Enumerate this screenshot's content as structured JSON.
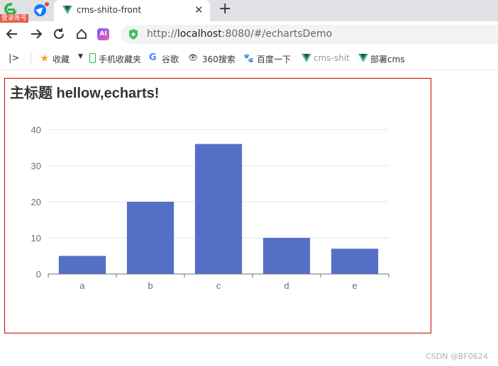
{
  "browser": {
    "login_badge": "登录账号",
    "tab": {
      "title": "cms-shito-front"
    },
    "new_tab_glyph": "+",
    "close_glyph": "✕",
    "ai_badge": "AI",
    "address": {
      "prefix": "http://",
      "host": "localhost",
      "rest": ":8080/#/echartsDemo"
    }
  },
  "bookmarks": [
    {
      "label": "收藏",
      "icon": "star-icon"
    },
    {
      "label": "手机收藏夹",
      "icon": "phone-icon"
    },
    {
      "label": "谷歌",
      "icon": "google-icon"
    },
    {
      "label": "360搜索",
      "icon": "eye-icon"
    },
    {
      "label": "百度一下",
      "icon": "baidu-paw-icon"
    },
    {
      "label": "cms-shit",
      "icon": "vue-icon"
    },
    {
      "label": "部署cms",
      "icon": "vue-icon"
    }
  ],
  "chart_data": {
    "type": "bar",
    "title": "主标题 hellow,echarts!",
    "categories": [
      "a",
      "b",
      "c",
      "d",
      "e"
    ],
    "values": [
      5,
      20,
      36,
      10,
      7
    ],
    "ylim": [
      0,
      40
    ],
    "yticks": [
      0,
      10,
      20,
      30,
      40
    ],
    "grid": "horizontal",
    "bar_color": "#5470c6"
  },
  "watermark": "CSDN @BF0624"
}
